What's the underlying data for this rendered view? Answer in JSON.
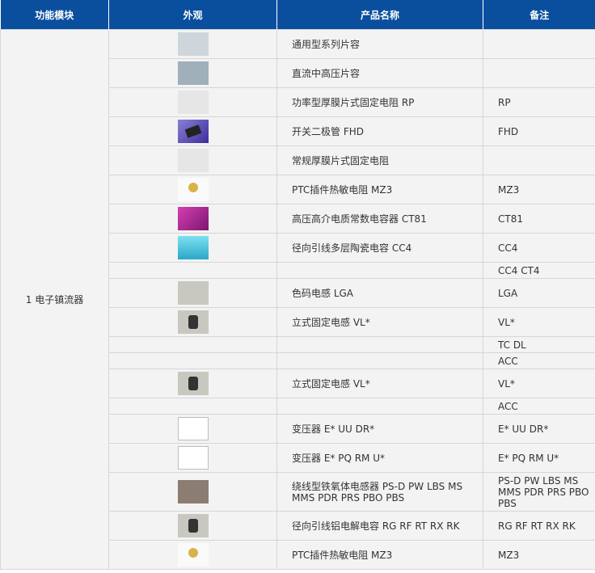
{
  "headers": [
    "功能模块",
    "外观",
    "产品名称",
    "备注"
  ],
  "module": "1 电子镇流器",
  "rows": [
    {
      "image": "grey-chip-capacitors-thumbnail",
      "name": "通用型系列片容",
      "note": ""
    },
    {
      "image": "high-voltage-chip-capacitors-thumbnail",
      "name": "直流中高压片容",
      "note": ""
    },
    {
      "image": "chip-resistor-thumbnail",
      "name": "功率型厚膜片式固定电阻 RP",
      "note": "RP"
    },
    {
      "image": "diode-thumbnail",
      "name": "开关二极管 FHD",
      "note": "FHD"
    },
    {
      "image": "resistor-331-thumbnail",
      "name": "常规厚膜片式固定电阻",
      "note": ""
    },
    {
      "image": "ptc-thermistor-thumbnail",
      "name": "PTC插件热敏电阻 MZ3",
      "note": "MZ3"
    },
    {
      "image": "ceramic-capacitor-magenta-thumbnail",
      "name": "高压高介电质常数电容器 CT81",
      "note": "CT81"
    },
    {
      "image": "multilayer-ceramic-capacitor-thumbnail",
      "name": "径向引线多层陶瓷电容 CC4",
      "note": "CC4"
    },
    {
      "image": "",
      "name": "",
      "note": "CC4 CT4"
    },
    {
      "image": "color-code-inductor-thumbnail",
      "name": "色码电感 LGA",
      "note": "LGA"
    },
    {
      "image": "vertical-inductor-thumbnail",
      "name": "立式固定电感 VL*",
      "note": "VL*"
    },
    {
      "image": "",
      "name": "",
      "note": "TC DL"
    },
    {
      "image": "",
      "name": "",
      "note": "ACC"
    },
    {
      "image": "vertical-inductor-thumbnail",
      "name": "立式固定电感 VL*",
      "note": "VL*"
    },
    {
      "image": "",
      "name": "",
      "note": "ACC"
    },
    {
      "image": "broken-image-icon",
      "name": "变压器 E* UU DR*",
      "note": "E* UU DR*"
    },
    {
      "image": "broken-image-icon",
      "name": "变压器 E* PQ RM U*",
      "note": "E* PQ RM U*"
    },
    {
      "image": "ferrite-inductor-board-thumbnail",
      "name": "绕线型铁氧体电感器 PS-D PW LBS MS MMS PDR PRS PBO PBS",
      "note": "PS-D PW LBS MS MMS PDR PRS PBO PBS"
    },
    {
      "image": "radial-electrolytic-capacitor-thumbnail",
      "name": "径向引线铝电解电容 RG RF RT RX RK",
      "note": "RG RF RT RX RK"
    },
    {
      "image": "ptc-thermistor-thumbnail",
      "name": "PTC插件热敏电阻 MZ3",
      "note": "MZ3"
    }
  ]
}
